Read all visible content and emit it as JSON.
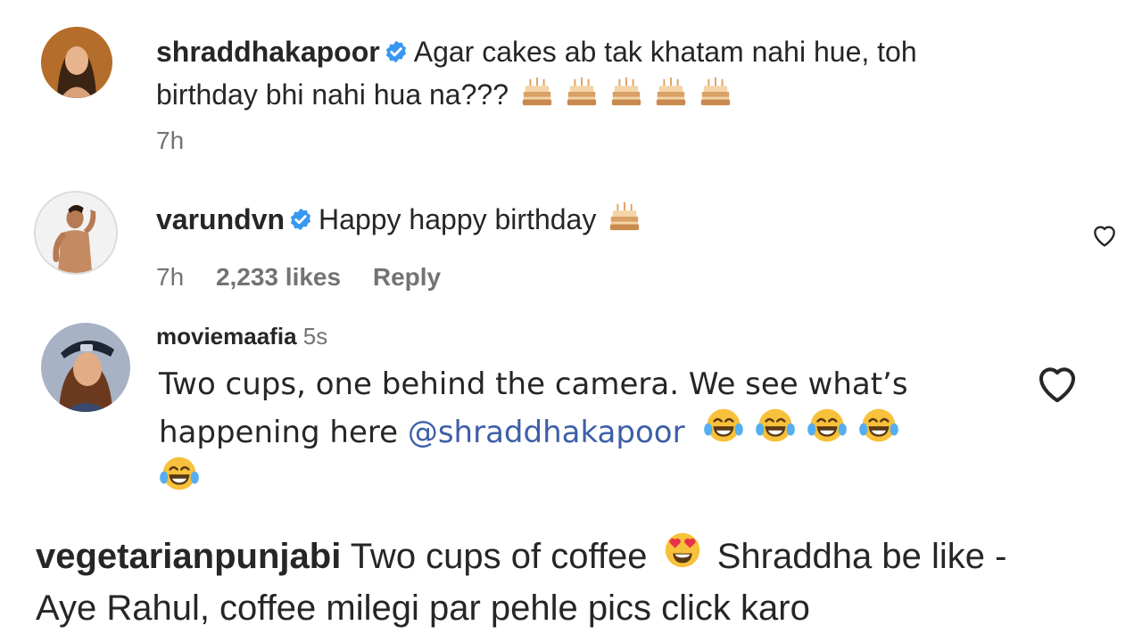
{
  "comments": [
    {
      "username": "shraddhakapoor",
      "verified": true,
      "text_line1": "Agar cakes ab tak khatam nahi hue, toh",
      "text_line2": "birthday bhi nahi hua na???",
      "emojis": [
        "cake-emoji",
        "cake-emoji",
        "cake-emoji",
        "cake-emoji",
        "cake-emoji"
      ],
      "time": "7h"
    },
    {
      "username": "varundvn",
      "verified": true,
      "text": "Happy happy birthday",
      "emojis": [
        "cake-emoji"
      ],
      "time": "7h",
      "likes": "2,233 likes",
      "reply": "Reply"
    },
    {
      "username": "moviemaafia",
      "time": "5s",
      "text_line1": "Two cups, one behind the camera. We see what’s",
      "text_line2": "happening here",
      "mention": "@shraddhakapoor",
      "emojis": [
        "joy-emoji",
        "joy-emoji",
        "joy-emoji",
        "joy-emoji",
        "joy-emoji"
      ]
    },
    {
      "username": "vegetarianpunjabi",
      "text_line1": "Two cups of coffee",
      "text_line1b": "Shraddha be like -",
      "text_line2": "Aye Rahul, coffee milegi par pehle pics click karo",
      "emojis": [
        "heart-eyes-emoji"
      ]
    }
  ],
  "colors": {
    "text": "#262626",
    "meta": "#737373",
    "verified": "#3897f0",
    "mention": "#3d5fa8"
  }
}
